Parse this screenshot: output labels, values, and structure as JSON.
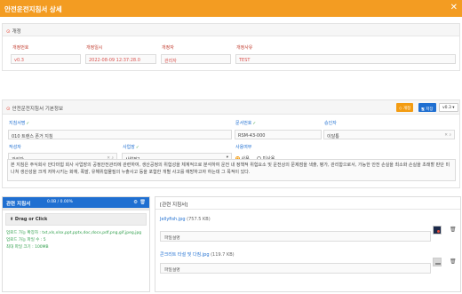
{
  "window": {
    "title": "안전운전지침서 상세",
    "close": "✕"
  },
  "revision": {
    "title": "개정",
    "labels": {
      "rev_no": "개정번호",
      "rev_date": "개정일시",
      "reviser": "개정자",
      "reason": "개정사유"
    },
    "values": {
      "rev_no": "v0.3",
      "rev_date": "2022-08-09 12:37:28.0",
      "reviser": "관리자",
      "reason": "TEST"
    }
  },
  "basic": {
    "title": "안전운전지침서 기본정보",
    "buttons": {
      "revise": "◇ 개정",
      "save": "🖫 저장",
      "version": "v0.3"
    },
    "labels": {
      "name": "지침서명",
      "doc_no": "문서번호",
      "approver": "승인자",
      "writer": "작성자",
      "dept": "사업장",
      "usage": "사용여부",
      "remark": "비고"
    },
    "values": {
      "name": "010 트랜스 폰거 지침",
      "doc_no": "RSM-43-000",
      "approver": "이달통",
      "writer": "관리자",
      "dept": "사업장1",
      "usage_yes": "사용",
      "usage_no": "미사용",
      "remark": "본 지침은 주식회사 안다마힘 회사 사업장의 공정안전관리에 관련하여, 생산공정의 위험성을 체계적으로 분석하여 운전 내 정책적 위험요소 및 운전상의 문제점을 색출, 평가, 관리함으로서, 가능한 안전 손실을 최소화 손실을 초래할 판단 미나쳐 생산성을 크게 저하시키는 화재, 폭발, 유해위험물질의 누출사고 등을 포함한 개별 사고를 예방하고자 하는데 그 목적이 있다."
    },
    "usage_selected": "사용"
  },
  "upload": {
    "title": "관련 지침서",
    "count": "0.0B / 0.00%",
    "progress": 0,
    "dropzone": "⬆ Drag or Click",
    "info": [
      "업로드 가능 확장자 : txt,xls,xlsx,ppt,pptx,doc,docx,pdf,png,gif,jpeg,jpg",
      "업로드 가능 파일 수 : 5",
      "최대 파일 크기 : 100MB"
    ]
  },
  "files": {
    "title": "[관련 지침서]",
    "items": [
      {
        "name": "Jellyfish.jpg",
        "size": "(757.5 KB)",
        "desc": "파일설명"
      },
      {
        "name": "콘크리트 타설 및 다짐.jpg",
        "size": "(119.7 KB)",
        "desc": "파일설명"
      }
    ]
  },
  "colors": {
    "accent": "#f39c22",
    "primary": "#1f6fd1",
    "danger": "#d9534f"
  }
}
